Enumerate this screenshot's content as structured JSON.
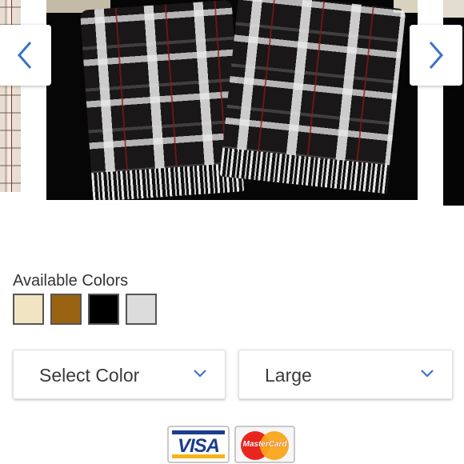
{
  "gallery": {
    "prev_icon": "chevron-left-icon",
    "next_icon": "chevron-right-icon",
    "accent": "#3a74c4"
  },
  "colors": {
    "label": "Available Colors",
    "swatches": [
      {
        "name": "cream",
        "color": "#f1e4c2"
      },
      {
        "name": "camel",
        "color": "#9a6312"
      },
      {
        "name": "black",
        "color": "#000000"
      },
      {
        "name": "light-gray",
        "color": "#dcdcdc"
      }
    ]
  },
  "selectors": {
    "color_value": "Select Color",
    "size_value": "Large",
    "chevron_icon": "chevron-down-icon",
    "chevron_color": "#3a74c4"
  },
  "payment": {
    "visa_label": "VISA",
    "mastercard_label": "MasterCard"
  }
}
